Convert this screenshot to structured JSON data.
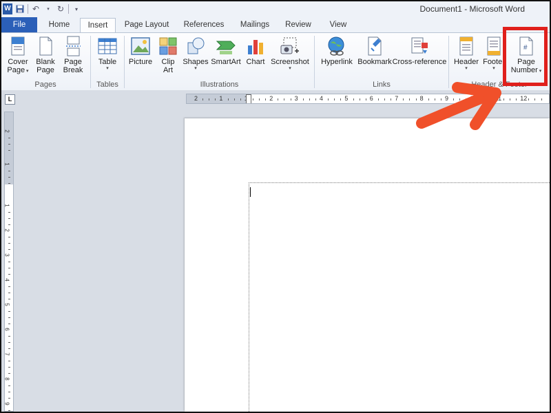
{
  "title_bar": {
    "title": "Document1  -  Microsoft Word"
  },
  "quick_access": {
    "logo_letter": "W",
    "icons": [
      "save-icon",
      "undo-icon",
      "redo-icon",
      "customize-icon"
    ]
  },
  "tabs": [
    {
      "label": "File"
    },
    {
      "label": "Home"
    },
    {
      "label": "Insert"
    },
    {
      "label": "Page Layout"
    },
    {
      "label": "References"
    },
    {
      "label": "Mailings"
    },
    {
      "label": "Review"
    },
    {
      "label": "View"
    }
  ],
  "active_tab": "Insert",
  "ribbon": {
    "groups": {
      "pages": "Pages",
      "tables": "Tables",
      "illustrations": "Illustrations",
      "links": "Links",
      "header_footer": "Header & Footer"
    },
    "buttons": {
      "cover_page": [
        "Cover",
        "Page"
      ],
      "blank_page": [
        "Blank",
        "Page"
      ],
      "page_break": [
        "Page",
        "Break"
      ],
      "table": "Table",
      "picture": "Picture",
      "clip_art": [
        "Clip",
        "Art"
      ],
      "shapes": "Shapes",
      "smartart": "SmartArt",
      "chart": "Chart",
      "screenshot": "Screenshot",
      "hyperlink": "Hyperlink",
      "bookmark": "Bookmark",
      "cross_reference": "Cross-reference",
      "header": "Header",
      "footer": "Footer",
      "page_number": [
        "Page",
        "Number"
      ]
    }
  },
  "ruler": {
    "horizontal_numbers": [
      "2",
      "1",
      "1",
      "2",
      "3",
      "4",
      "5",
      "6",
      "7",
      "8",
      "9",
      "10",
      "11",
      "12"
    ],
    "vertical_numbers": [
      "2",
      "1",
      "1",
      "2",
      "3",
      "4",
      "5",
      "6",
      "7",
      "8",
      "9"
    ],
    "tab_selector": "L"
  },
  "colors": {
    "file_tab": "#2b5fb8",
    "highlight": "#e0201c",
    "arrow": "#f0502a"
  }
}
